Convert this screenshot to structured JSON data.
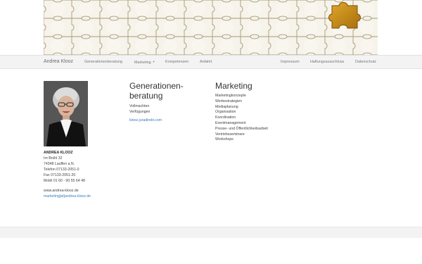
{
  "banner": {
    "image": "puzzle-banner"
  },
  "navbar": {
    "brand": "Andrea Klooz",
    "left_items": [
      {
        "label": "Generationenberatung"
      },
      {
        "label": "Marketing",
        "dropdown": true
      },
      {
        "label": "Kompetenzen"
      },
      {
        "label": "Anfahrt"
      }
    ],
    "right_items": [
      {
        "label": "Impressum"
      },
      {
        "label": "Haftungsausschluss"
      },
      {
        "label": "Datenschutz"
      }
    ]
  },
  "contact": {
    "name": "ANDREA KLOOZ",
    "street": "Im Brühl 32",
    "city": "74348 Lauffen a.N.",
    "phone": "Telefon 07133-2051-0",
    "fax": "Fax 07133-2051-20",
    "mobile": "Mobil 01 60 - 90 55 64 48",
    "website": "www.andrea-klooz.de",
    "email": "marketing[at]andrea-klooz.de"
  },
  "generationen": {
    "title": "Generationen-beratung",
    "items": [
      "Vollmachten",
      "Verfügungen"
    ],
    "link": "klooz.juradirekt.com"
  },
  "marketing": {
    "title": "Marketing",
    "items": [
      "Marketingkonzepte",
      "Werbestrategien",
      "Mediaplanung",
      "Organisation",
      "Koordination",
      "Eventmanagement",
      "Presse- und Öffentlichkeitsarbeit",
      "Vertriebsseminare",
      "Workshops"
    ]
  },
  "colors": {
    "link": "#3a7bbf",
    "navbar_bg": "#f3f3f3",
    "puzzle_accent": "#c8901a"
  }
}
